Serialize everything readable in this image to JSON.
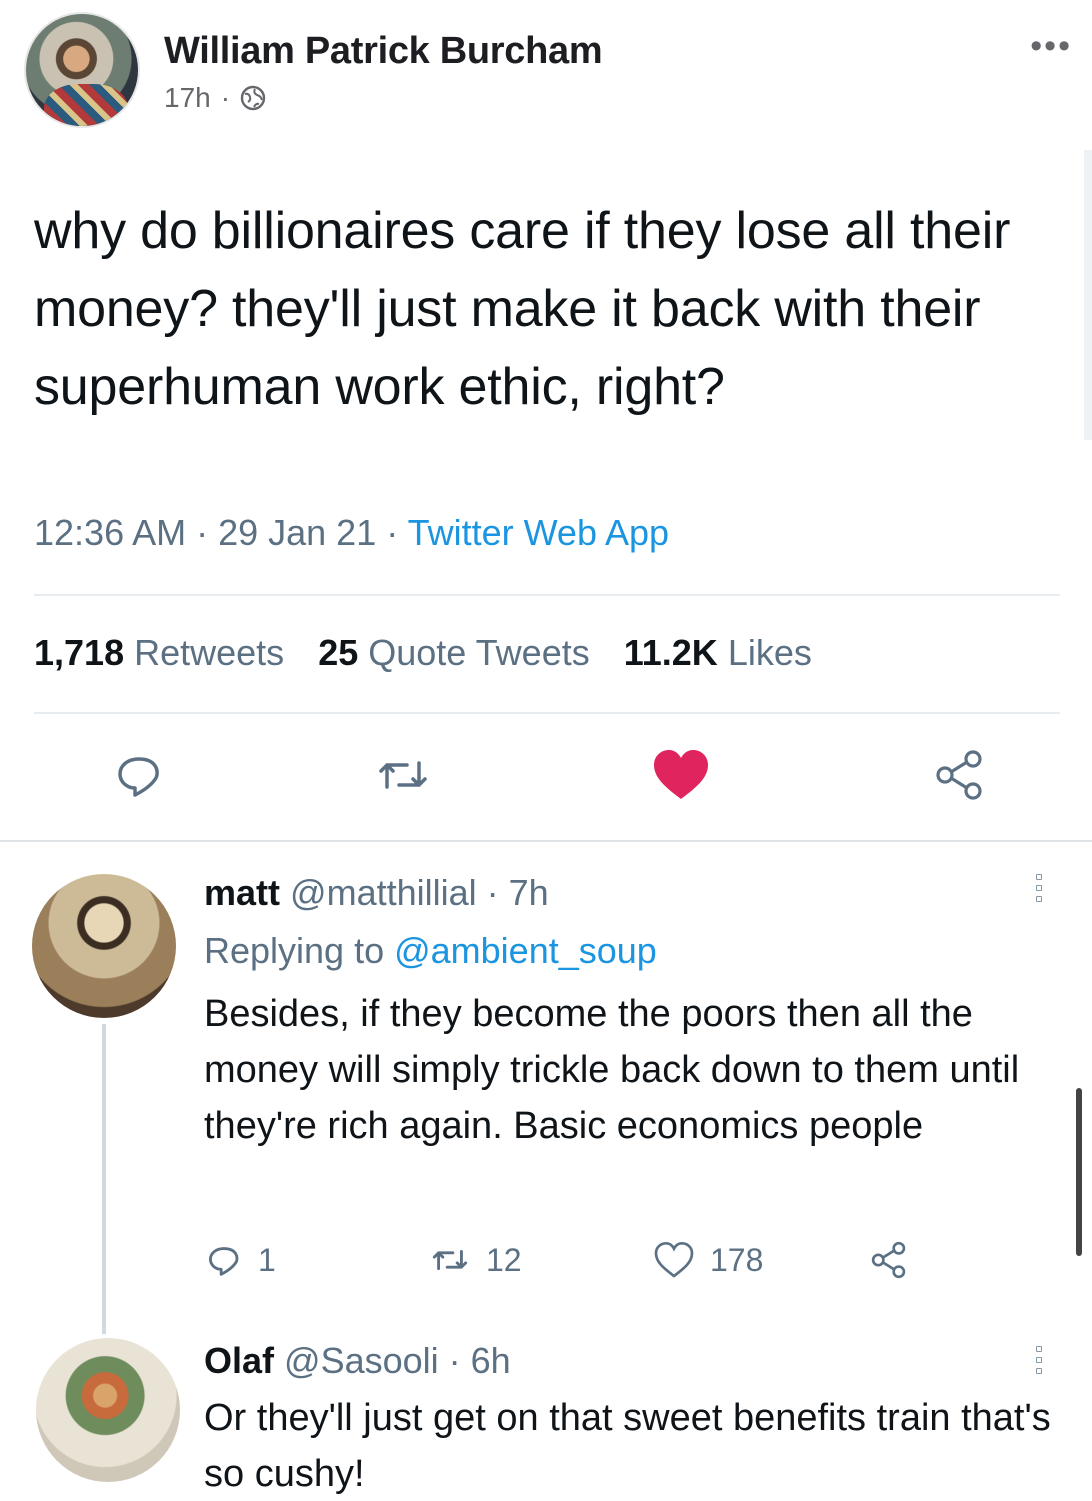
{
  "post": {
    "author": "William Patrick Burcham",
    "time": "17h",
    "separator": "·",
    "privacy_icon": "globe-icon",
    "more_icon": "•••"
  },
  "tweet": {
    "text": "why do billionaires care if they lose all their money? they'll just make it back with their superhuman work ethic, right?",
    "time": "12:36 AM · 29 Jan 21 · ",
    "source": "Twitter Web App",
    "retweets_count": "1,718",
    "retweets_label": "Retweets",
    "quotes_count": "25",
    "quotes_label": "Quote Tweets",
    "likes_count": "11.2K",
    "likes_label": "Likes",
    "liked": true,
    "like_color": "#e0245e"
  },
  "replies": [
    {
      "name": "matt",
      "handle": "@matthillial · 7h",
      "replying_label": "Replying to ",
      "replying_to": "@ambient_soup",
      "text": "Besides, if they become the poors then all the money will simply trickle back down to them until they're rich again. Basic economics people",
      "reply_count": "1",
      "retweet_count": "12",
      "like_count": "178"
    },
    {
      "name": "Olaf",
      "handle": "@Sasooli · 6h",
      "text": "Or they'll just get on that sweet benefits train that's so cushy!"
    }
  ],
  "colors": {
    "accent": "#1b95e0",
    "muted": "#5b7083",
    "text": "#0f1419"
  }
}
